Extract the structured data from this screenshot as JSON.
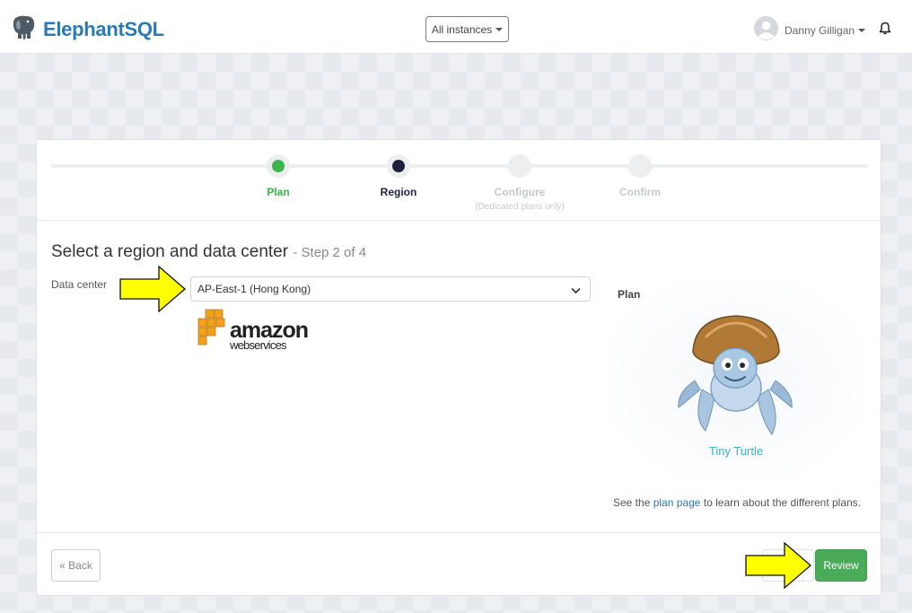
{
  "app": {
    "name": "ElephantSQL"
  },
  "header": {
    "instances_label": "All instances",
    "user_name": "Danny Gilligan"
  },
  "stepper": {
    "steps": [
      {
        "label": "Plan",
        "sublabel": "",
        "state": "complete",
        "color": "#3cb54a"
      },
      {
        "label": "Region",
        "sublabel": "",
        "state": "active",
        "color": "#1f2140"
      },
      {
        "label": "Configure",
        "sublabel": "(Dedicated plans only)",
        "state": "pending",
        "color": "#c5c9ce"
      },
      {
        "label": "Confirm",
        "sublabel": "",
        "state": "pending",
        "color": "#c5c9ce"
      }
    ]
  },
  "main": {
    "title": "Select a region and data center",
    "step_of": "- Step 2 of 4",
    "data_center_label": "Data center",
    "data_center_value": "AP-East-1 (Hong Kong)",
    "provider_logo": {
      "line1": "amazon",
      "line2": "webservices"
    }
  },
  "plan": {
    "label": "Plan",
    "name": "Tiny Turtle",
    "note_before": "See the",
    "note_link": "plan page",
    "note_after": "to learn about the different plans."
  },
  "footer": {
    "back_label": "« Back",
    "review_label": "Review"
  },
  "colors": {
    "brand": "#2a7ab8",
    "review_green": "#4aab59",
    "plan_name": "#3ab0cc",
    "annotation_arrow": "#ffff00"
  }
}
